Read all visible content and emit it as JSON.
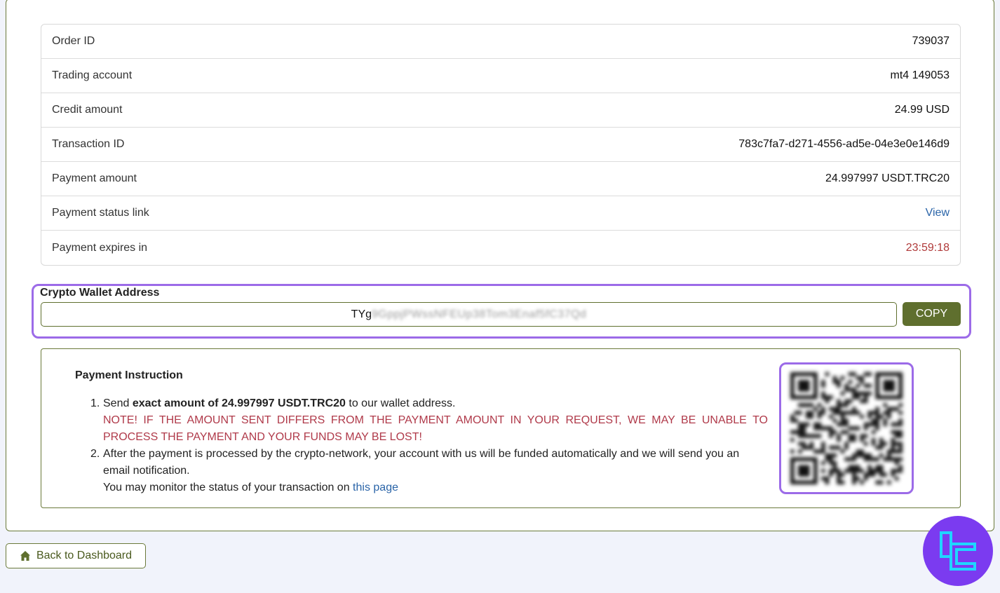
{
  "order": {
    "rows": [
      {
        "label": "Order ID",
        "value": "739037",
        "kind": "plain"
      },
      {
        "label": "Trading account",
        "value": "mt4 149053",
        "kind": "plain"
      },
      {
        "label": "Credit amount",
        "value": "24.99 USD",
        "kind": "plain"
      },
      {
        "label": "Transaction ID",
        "value": "783c7fa7-d271-4556-ad5e-04e3e0e146d9",
        "kind": "plain"
      },
      {
        "label": "Payment amount",
        "value": "24.997997 USDT.TRC20",
        "kind": "plain"
      },
      {
        "label": "Payment status link",
        "value": "View",
        "kind": "link"
      },
      {
        "label": "Payment expires in",
        "value": "23:59:18",
        "kind": "timer"
      }
    ]
  },
  "wallet": {
    "label": "Crypto Wallet Address",
    "address_prefix": "TYg",
    "address_blurred": "9GppjPWssNFEUp38Tom3Enaf5fC37Qd",
    "copy_label": "COPY"
  },
  "instruction": {
    "title": "Payment Instruction",
    "step1_num": "1.",
    "step1_pre": "Send ",
    "step1_bold": "exact amount of 24.997997 USDT.TRC20",
    "step1_post": " to our wallet address.",
    "step1_warning": "NOTE! IF THE AMOUNT SENT DIFFERS FROM THE PAYMENT AMOUNT IN YOUR REQUEST, WE MAY BE UNABLE TO PROCESS THE PAYMENT AND YOUR FUNDS MAY BE LOST!",
    "step2_num": "2.",
    "step2_text": "After the payment is processed by the crypto-network, your account with us will be funded automatically and we will send you an email notification.",
    "step2_monitor": "You may monitor the status of your transaction on ",
    "step2_link": "this page"
  },
  "footer": {
    "back_label": "Back to Dashboard"
  },
  "colors": {
    "accent": "#5f6f2e",
    "highlight": "#9c6be8",
    "warning": "#b03a4a",
    "link": "#2a64a8",
    "logo_bg": "#7b3bf0"
  }
}
